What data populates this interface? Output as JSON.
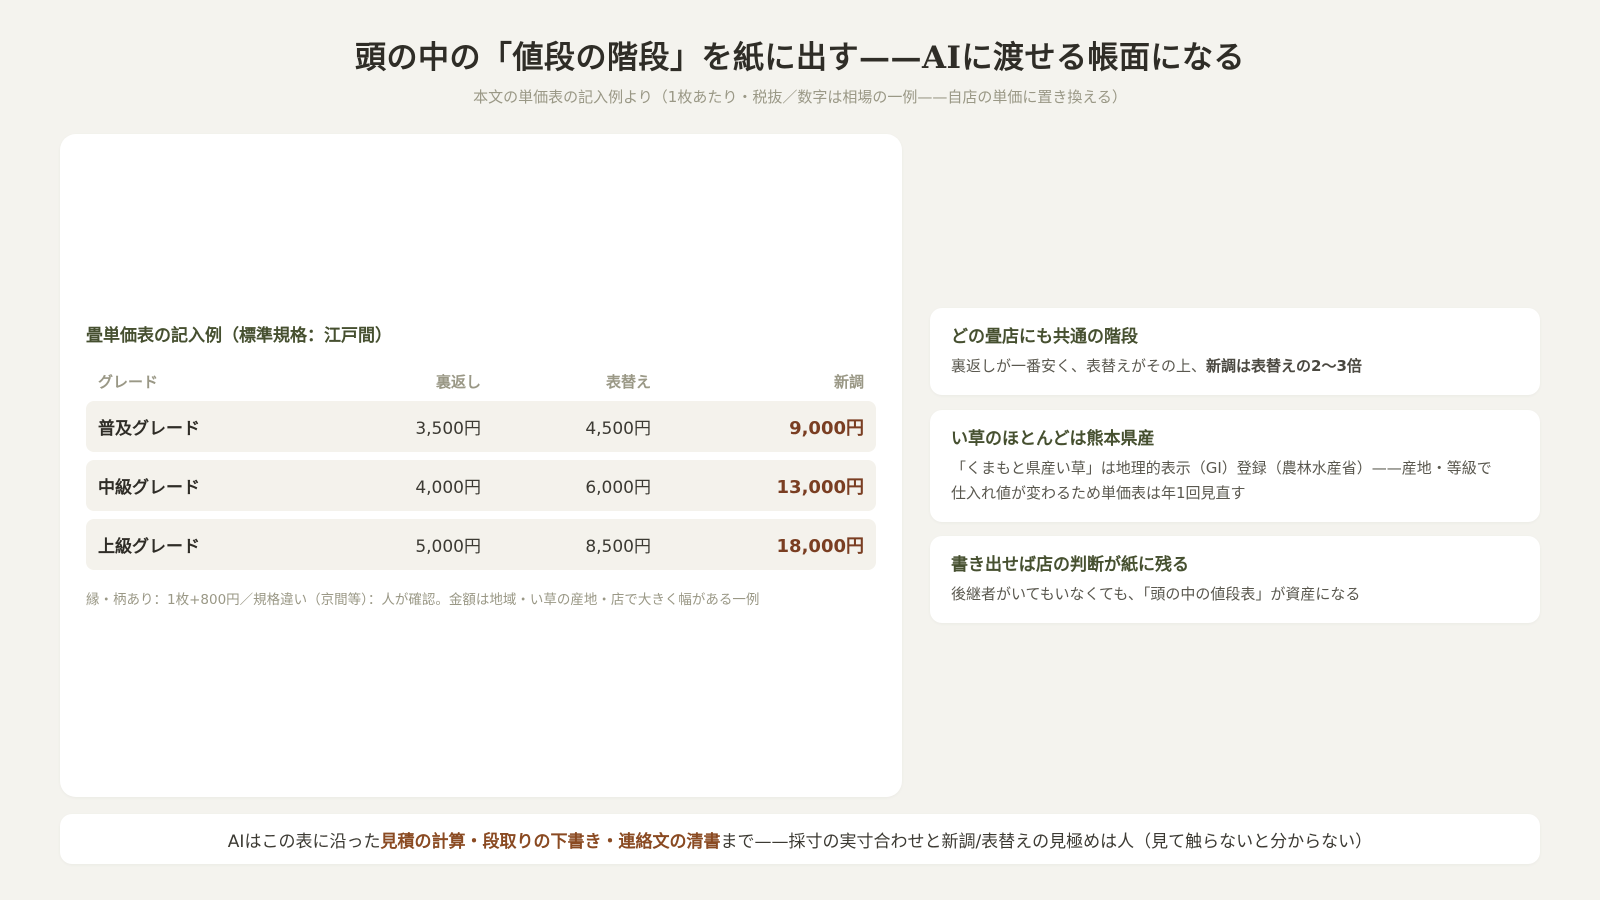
{
  "header": {
    "title": "頭の中の「値段の階段」を紙に出す——AIに渡せる帳面になる",
    "subtitle": "本文の単価表の記入例より（1枚あたり・税抜／数字は相場の一例——自店の単価に置き換える）"
  },
  "price_table": {
    "title": "畳単価表の記入例（標準規格：江戸間）",
    "columns": {
      "grade": "グレード",
      "uragaeshi": "裏返し",
      "omotegae": "表替え",
      "shinchou": "新調"
    },
    "rows": [
      {
        "grade": "普及グレード",
        "uragaeshi": "3,500円",
        "omotegae": "4,500円",
        "shinchou": "9,000円"
      },
      {
        "grade": "中級グレード",
        "uragaeshi": "4,000円",
        "omotegae": "6,000円",
        "shinchou": "13,000円"
      },
      {
        "grade": "上級グレード",
        "uragaeshi": "5,000円",
        "omotegae": "8,500円",
        "shinchou": "18,000円"
      }
    ],
    "note": "縁・柄あり：1枚+800円／規格違い（京間等）：人が確認。金額は地域・い草の産地・店で大きく幅がある一例"
  },
  "cards": [
    {
      "title": "どの畳店にも共通の階段",
      "text_plain": "裏返しが一番安く、表替えがその上、",
      "text_bold": "新調は表替えの2〜3倍"
    },
    {
      "title": "い草のほとんどは熊本県産",
      "text_line1": "「くまもと県産い草」は地理的表示（GI）登録（農林水産省）——産地・等級で",
      "text_line2": "仕入れ値が変わるため単価表は年1回見直す"
    },
    {
      "title": "書き出せば店の判断が紙に残る",
      "text": "後継者がいてもいなくても、「頭の中の値段表」が資産になる"
    }
  ],
  "bottom": {
    "prefix": "AIはこの表に沿った",
    "highlight": "見積の計算・段取りの下書き・連絡文の清書",
    "suffix": "まで——採寸の実寸合わせと新調/表替えの見極めは人（見て触らないと分からない）"
  },
  "colors": {
    "background": "#f4f3ee",
    "accent_green": "#465030",
    "accent_brown": "#7a3e22",
    "muted": "#9a9886"
  }
}
